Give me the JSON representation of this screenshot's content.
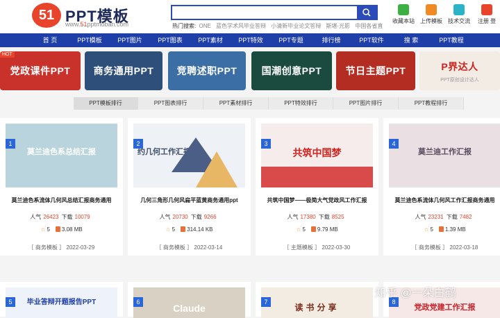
{
  "header": {
    "logo_badge": "51",
    "logo_title": "PPT模板",
    "logo_url_prefix": "www.",
    "logo_url_brand": "51",
    "logo_url_suffix": "pptmoban.com",
    "search_placeholder": "",
    "hot_label": "热门搜索:",
    "hot_terms": [
      "ONE",
      "蓝色学术风毕业答辩",
      "小清新毕业论文答辩",
      "斯堪·光影",
      "中国各省直"
    ],
    "tools": [
      {
        "label": "收藏本站",
        "color": "#3cb043"
      },
      {
        "label": "上传模板",
        "color": "#f08a24"
      },
      {
        "label": "技术交流",
        "color": "#2bb3c7"
      },
      {
        "label": "注册 登",
        "color": "#e8442b"
      }
    ]
  },
  "nav": {
    "items": [
      "首 页",
      "PPT模板",
      "PPT图片",
      "PPT图表",
      "PPT素材",
      "PPT特效",
      "PPT专题",
      "排行榜",
      "PPT软件",
      "搜 索",
      "PPT教程"
    ]
  },
  "banners": [
    {
      "label": "党政课件PPT",
      "color": "#c8322a",
      "hot": "HOT"
    },
    {
      "label": "商务通用PPT",
      "color": "#2d4f7a"
    },
    {
      "label": "竞聘述职PPT",
      "color": "#3a6ea5"
    },
    {
      "label": "国潮创意PPT",
      "color": "#1b4a3f"
    },
    {
      "label": "节日主题PPT",
      "color": "#b32d22"
    },
    {
      "label": "P界达人",
      "color": "#f3ece4",
      "sub": "PPT原创设计达人"
    }
  ],
  "tabs": [
    "PPT模板排行",
    "PPT图表排行",
    "PPT素材排行",
    "PPT特效排行",
    "PPT图片排行",
    "PPT教程排行"
  ],
  "labels": {
    "popularity": "人气",
    "downloads": "下载"
  },
  "cards": [
    {
      "num": "1",
      "thumb_title": "莫兰迪色系总结汇报",
      "thumb_bg": "#b9d4dc",
      "thumb_color": "#ffffff",
      "title": "莫兰迪色系流体几何风总结汇报商务通用",
      "views": "26423",
      "downloads": "10079",
      "stars": "5",
      "size": "3.08 MB",
      "category": "［ 商务模板 ］",
      "date": "2022-03-29"
    },
    {
      "num": "2",
      "thumb_title": "约几何工作汇报",
      "thumb_bg": "#eef1f5",
      "thumb_color": "#3f4e6b",
      "title": "几何三角形几何风扁平蓝黄商务通用ppt",
      "views": "20730",
      "downloads": "9266",
      "stars": "5",
      "size": "314.14 KB",
      "category": "［ 商务模板 ］",
      "date": "2022-03-14"
    },
    {
      "num": "3",
      "thumb_title": "共筑中国梦",
      "thumb_bg": "#f6ecec",
      "thumb_color": "#d0231f",
      "title": "共筑中国梦——极简大气党政风工作汇报",
      "views": "17380",
      "downloads": "8525",
      "stars": "5",
      "size": "9.79 MB",
      "category": "［ 主题模板 ］",
      "date": "2022-03-30"
    },
    {
      "num": "4",
      "thumb_title": "莫兰迪工作汇报",
      "thumb_bg": "#eadfe3",
      "thumb_color": "#5a4a5e",
      "title": "莫兰迪色系流体几何风工作汇报商务通用",
      "views": "23231",
      "downloads": "7482",
      "stars": "5",
      "size": "1.39 MB",
      "category": "［ 商务模板 ］",
      "date": "2022-03-18"
    }
  ],
  "cards_row2": [
    {
      "num": "5",
      "thumb_title": "毕业答辩开题报告PPT",
      "thumb_bg": "#eef2fa",
      "thumb_color": "#1f3fa8"
    },
    {
      "num": "6",
      "thumb_title": "Claude",
      "thumb_bg": "#d9d2c4",
      "thumb_color": "#ffffff"
    },
    {
      "num": "7",
      "thumb_title": "读书分享",
      "thumb_bg": "#f3ece2",
      "thumb_color": "#7a2c1e"
    },
    {
      "num": "8",
      "thumb_title": "党政党建工作汇报",
      "thumb_bg": "#f6e8e6",
      "thumb_color": "#c8232a"
    }
  ],
  "watermark": "知乎 @一朵白鹤"
}
